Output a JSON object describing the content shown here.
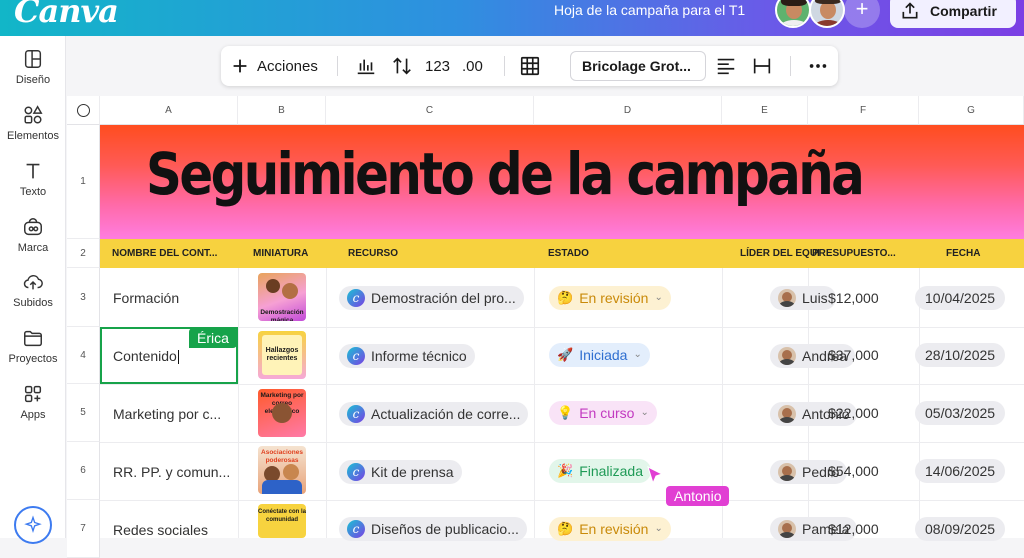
{
  "app": {
    "logo": "Canva",
    "doc_title": "Hoja de la campaña para el T1",
    "share_label": "Compartir",
    "add_label": "+"
  },
  "sidebar": {
    "items": [
      {
        "label": "Diseño",
        "icon": "layout-icon"
      },
      {
        "label": "Elementos",
        "icon": "shapes-icon"
      },
      {
        "label": "Texto",
        "icon": "text-icon"
      },
      {
        "label": "Marca",
        "icon": "brand-icon"
      },
      {
        "label": "Subidos",
        "icon": "upload-cloud-icon"
      },
      {
        "label": "Proyectos",
        "icon": "folder-icon"
      },
      {
        "label": "Apps",
        "icon": "apps-icon"
      }
    ]
  },
  "toolbar": {
    "actions_label": "Acciones",
    "number_format": "123",
    "decimals": ".00",
    "font_name": "Bricolage Grot..."
  },
  "sheet": {
    "columns": [
      "A",
      "B",
      "C",
      "D",
      "E",
      "F",
      "G"
    ],
    "row_numbers": [
      "1",
      "2",
      "3",
      "4",
      "5",
      "6",
      "7"
    ],
    "banner_title": "Seguimiento de la campaña",
    "headers": [
      "NOMBRE DEL CONT...",
      "MINIATURA",
      "RECURSO",
      "ESTADO",
      "LÍDER DEL EQUI",
      "PRESUPUESTO...",
      "FECHA"
    ],
    "rows": [
      {
        "name": "Formación",
        "thumb_text": "Demostración mágica",
        "resource": "Demostración del pro...",
        "status": "En revisión",
        "status_emoji": "🤔",
        "leader": "Luis",
        "budget": "$12,000",
        "date": "10/04/2025"
      },
      {
        "name": "Contenido",
        "thumb_text": "Hallazgos recientes",
        "resource": "Informe técnico",
        "status": "Iniciada",
        "status_emoji": "🚀",
        "leader": "Andrea",
        "budget": "$37,000",
        "date": "28/10/2025"
      },
      {
        "name": "Marketing por c...",
        "thumb_text": "Marketing por correo electrónico",
        "resource": "Actualización de corre...",
        "status": "En curso",
        "status_emoji": "💡",
        "leader": "Antonio",
        "budget": "$22,000",
        "date": "05/03/2025"
      },
      {
        "name": "RR. PP. y comun...",
        "thumb_text": "Asociaciones poderosas",
        "resource": "Kit de prensa",
        "status": "Finalizada",
        "status_emoji": "🎉",
        "leader": "Pedro",
        "budget": "$54,000",
        "date": "14/06/2025"
      },
      {
        "name": "Redes sociales",
        "thumb_text": "Conéctate con la comunidad",
        "resource": "Diseños de publicacio...",
        "status": "En revisión",
        "status_emoji": "🤔",
        "leader": "Pamela",
        "budget": "$12,000",
        "date": "08/09/2025"
      }
    ]
  },
  "collaborators": {
    "erica": {
      "name": "Érica",
      "color": "#16a34a"
    },
    "antonio": {
      "name": "Antonio",
      "color": "#e13fd3"
    }
  },
  "status_colors": {
    "En revisión": {
      "bg": "#fdf1d2",
      "fg": "#c98a0a"
    },
    "Iniciada": {
      "bg": "#e3eefc",
      "fg": "#2f6fd0"
    },
    "En curso": {
      "bg": "#f9e3f7",
      "fg": "#c23ac0"
    },
    "Finalizada": {
      "bg": "#e2f6ea",
      "fg": "#1f9a56"
    }
  }
}
